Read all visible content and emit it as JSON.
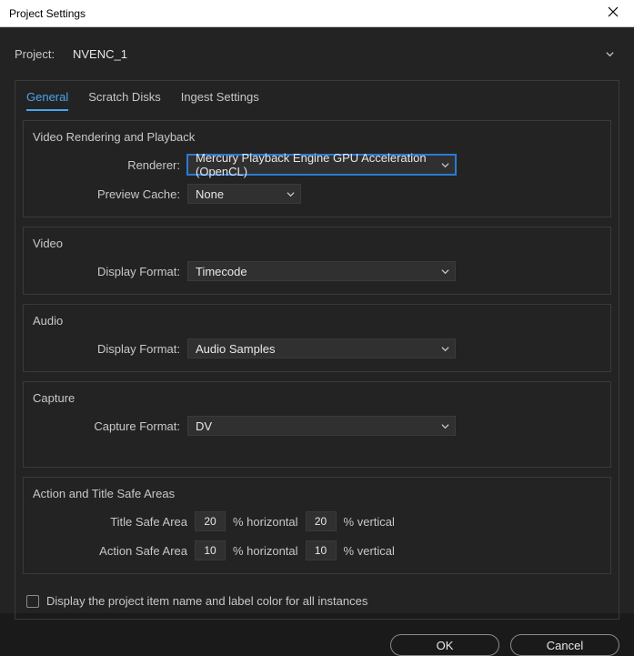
{
  "titlebar": {
    "title": "Project Settings"
  },
  "project": {
    "label": "Project:",
    "value": "NVENC_1"
  },
  "tabs": {
    "general": "General",
    "scratch": "Scratch Disks",
    "ingest": "Ingest Settings"
  },
  "sections": {
    "rendering": {
      "title": "Video Rendering and Playback",
      "renderer_label": "Renderer:",
      "renderer_value": "Mercury Playback Engine GPU Acceleration (OpenCL)",
      "cache_label": "Preview Cache:",
      "cache_value": "None"
    },
    "video": {
      "title": "Video",
      "format_label": "Display Format:",
      "format_value": "Timecode"
    },
    "audio": {
      "title": "Audio",
      "format_label": "Display Format:",
      "format_value": "Audio Samples"
    },
    "capture": {
      "title": "Capture",
      "format_label": "Capture Format:",
      "format_value": "DV"
    },
    "safeareas": {
      "title": "Action and Title Safe Areas",
      "title_safe_label": "Title Safe Area",
      "action_safe_label": "Action Safe Area",
      "horizontal_unit": "% horizontal",
      "vertical_unit": "% vertical",
      "title_h": "20",
      "title_v": "20",
      "action_h": "10",
      "action_v": "10"
    }
  },
  "checkbox": {
    "label": "Display the project item name and label color for all instances"
  },
  "footer": {
    "ok": "OK",
    "cancel": "Cancel"
  }
}
